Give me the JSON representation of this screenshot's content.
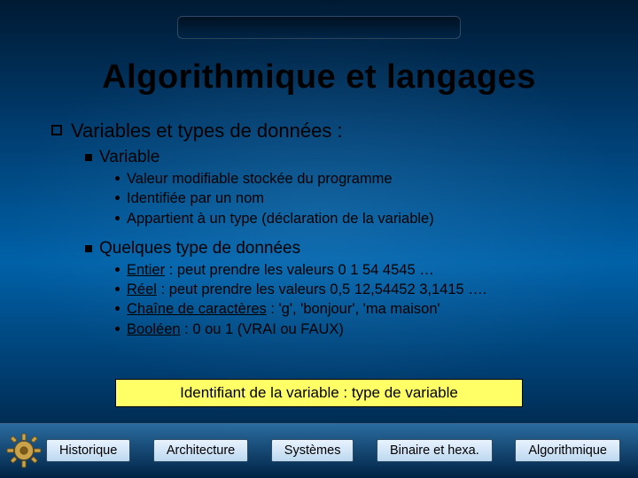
{
  "title": "Algorithmique et langages",
  "section": {
    "heading": "Variables et types de données :",
    "items": [
      {
        "label": "Variable",
        "points": [
          "Valeur modifiable stockée du programme",
          "Identifiée par un nom",
          "Appartient à un type (déclaration de la variable)"
        ]
      },
      {
        "label": "Quelques type de données",
        "types": [
          {
            "name": "Entier",
            "desc": " : peut prendre les valeurs 0  1  54  4545 …"
          },
          {
            "name": "Réel",
            "desc": " : peut prendre les valeurs 0,5  12,54452 3,1415 …."
          },
          {
            "name": "Chaîne de caractères",
            "desc": " : 'g', 'bonjour', 'ma maison'"
          },
          {
            "name": "Booléen",
            "desc": " : 0 ou 1 (VRAI ou FAUX)"
          }
        ]
      }
    ]
  },
  "callout": "Identifiant de la variable : type de variable",
  "nav": {
    "items": [
      "Historique",
      "Architecture",
      "Systèmes",
      "Binaire et hexa.",
      "Algorithmique"
    ]
  }
}
